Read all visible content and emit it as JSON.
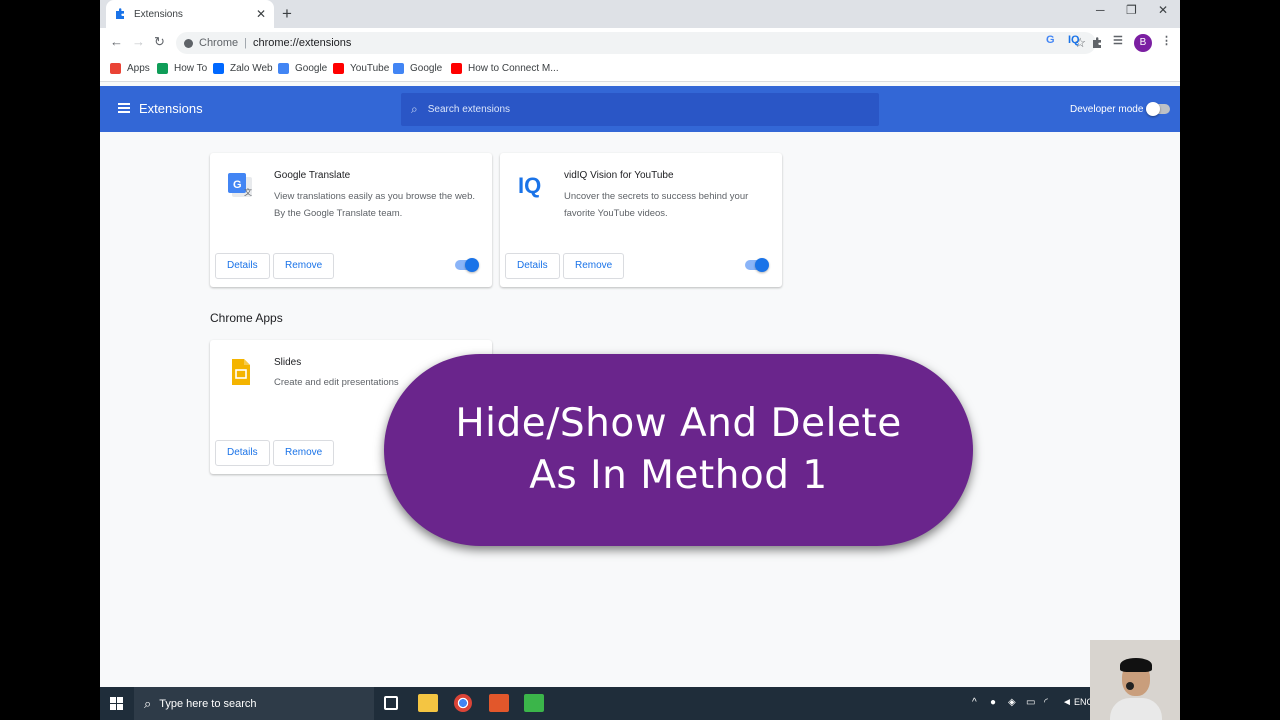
{
  "browser": {
    "tab_title": "Extensions",
    "omnibox_scheme": "Chrome",
    "omnibox_url": "chrome://extensions",
    "avatar_letter": "B",
    "ext_icon_iq": "IQ"
  },
  "bookmarks": [
    {
      "label": "Apps",
      "icon": "apps-grid-icon",
      "color": "#ea4335"
    },
    {
      "label": "How To",
      "icon": "sheets-icon",
      "color": "#0f9d58"
    },
    {
      "label": "Zalo Web",
      "icon": "zalo-icon",
      "color": "#0068ff"
    },
    {
      "label": "Google",
      "icon": "google-icon",
      "color": "#4285f4"
    },
    {
      "label": "YouTube",
      "icon": "youtube-icon",
      "color": "#ff0000"
    },
    {
      "label": "Google",
      "icon": "translate-icon",
      "color": "#4285f4"
    },
    {
      "label": "How to Connect M...",
      "icon": "youtube-icon",
      "color": "#ff0000"
    }
  ],
  "header": {
    "title": "Extensions",
    "search_placeholder": "Search extensions",
    "developer_mode_label": "Developer mode",
    "developer_mode_on": false
  },
  "extensions": [
    {
      "name": "Google Translate",
      "description": "View translations easily as you browse the web. By the Google Translate team.",
      "details_label": "Details",
      "remove_label": "Remove",
      "enabled": true
    },
    {
      "name": "vidIQ Vision for YouTube",
      "description": "Uncover the secrets to success behind your favorite YouTube videos.",
      "details_label": "Details",
      "remove_label": "Remove",
      "enabled": true,
      "logo_text": "IQ"
    }
  ],
  "chrome_apps": {
    "section_title": "Chrome Apps",
    "apps": [
      {
        "name": "Slides",
        "description": "Create and edit presentations",
        "details_label": "Details",
        "remove_label": "Remove"
      }
    ]
  },
  "overlay": {
    "line1": "Hide/Show And Delete",
    "line2": "As In Method 1",
    "color": "#6a258c"
  },
  "taskbar": {
    "search_placeholder": "Type here to search",
    "language": "ENG"
  },
  "colors": {
    "header_blue": "#3367d6",
    "accent_blue": "#1a73e8"
  }
}
